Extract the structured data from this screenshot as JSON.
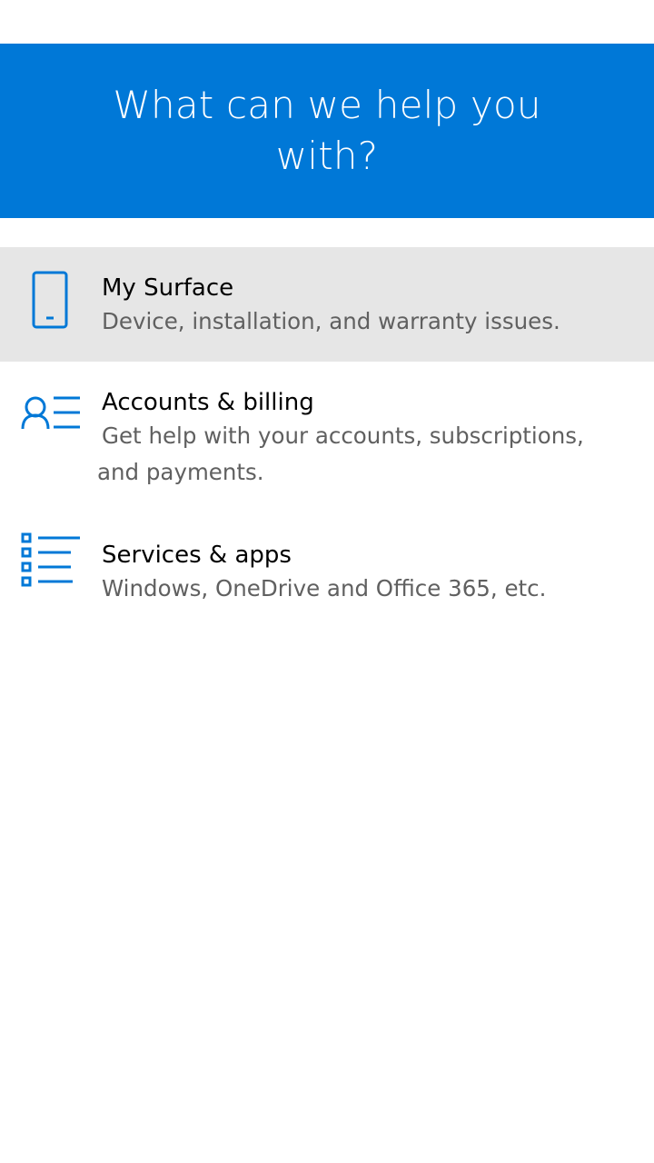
{
  "header": {
    "title": "What can we help you with?"
  },
  "colors": {
    "accent": "#0078d7",
    "selected_bg": "#e6e6e6",
    "title_text": "#000000",
    "description_text": "#606060"
  },
  "categories": [
    {
      "icon": "phone-device-icon",
      "title": "My Surface",
      "description": "Device, installation, and warranty issues.",
      "selected": true
    },
    {
      "icon": "person-list-icon",
      "title": "Accounts & billing",
      "description": "Get help with your accounts, subscriptions, and payments.",
      "selected": false
    },
    {
      "icon": "bulleted-list-icon",
      "title": "Services & apps",
      "description": "Windows, OneDrive and Office 365, etc.",
      "selected": false
    }
  ]
}
